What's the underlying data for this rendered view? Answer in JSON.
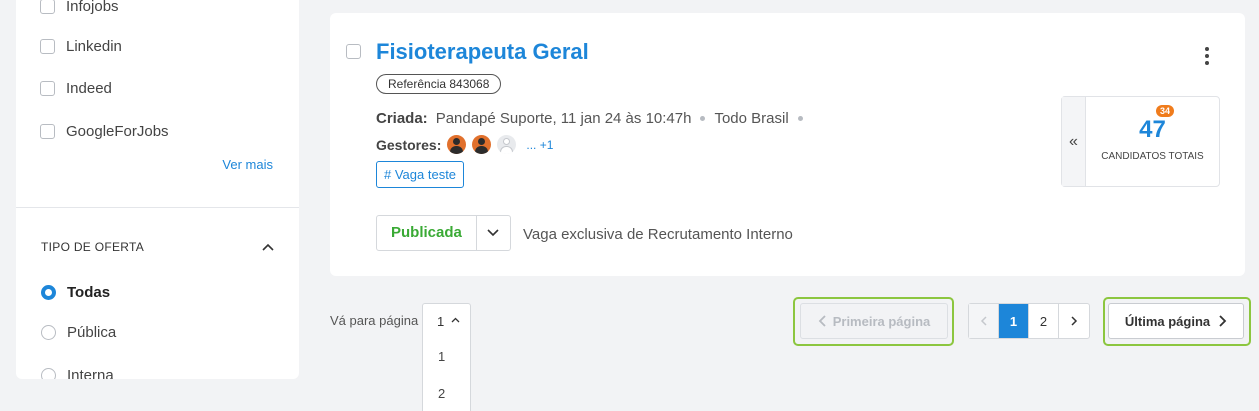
{
  "sidebar": {
    "sources": [
      {
        "label": "Infojobs",
        "checked": false
      },
      {
        "label": "Linkedin",
        "checked": false
      },
      {
        "label": "Indeed",
        "checked": false
      },
      {
        "label": "GoogleForJobs",
        "checked": false
      }
    ],
    "ver_mais": "Ver mais",
    "tipo_oferta": {
      "title": "TIPO DE OFERTA",
      "options": [
        {
          "label": "Todas",
          "selected": true
        },
        {
          "label": "Pública",
          "selected": false
        },
        {
          "label": "Interna",
          "selected": false
        }
      ]
    }
  },
  "job": {
    "title": "Fisioterapeuta Geral",
    "reference": "Referência 843068",
    "criada_label": "Criada:",
    "criada_value": "Pandapé Suporte, 11 jan 24 às 10:47h",
    "location": "Todo Brasil",
    "gestores_label": "Gestores:",
    "gestores_more": "... +1",
    "tag": "# Vaga teste",
    "status": "Publicada",
    "note": "Vaga exclusiva de Recrutamento Interno",
    "candidates": {
      "total": "47",
      "new_badge": "34",
      "label": "CANDIDATOS TOTAIS",
      "collapse_icon": "«"
    }
  },
  "pagination": {
    "goto_label": "Vá para página",
    "selected_page": "1",
    "options": [
      "1",
      "2"
    ],
    "first_page": "Primeira página",
    "pages": [
      "1",
      "2"
    ],
    "current_page": "1",
    "last_page": "Última página"
  },
  "colors": {
    "accent": "#1d86d9",
    "status_green": "#3aaa35",
    "badge_orange": "#f07c1c",
    "highlight": "#8cc63f"
  }
}
